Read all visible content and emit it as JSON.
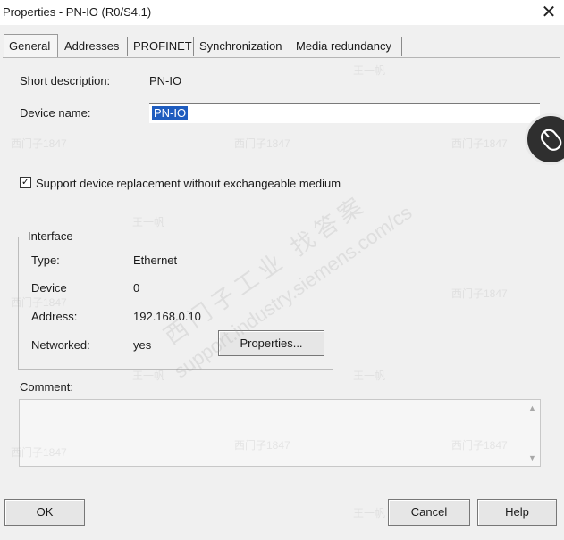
{
  "window": {
    "title": "Properties - PN-IO (R0/S4.1)",
    "close_glyph": "✕"
  },
  "tabs": [
    {
      "label": "General",
      "active": true
    },
    {
      "label": "Addresses",
      "active": false
    },
    {
      "label": "PROFINET",
      "active": false
    },
    {
      "label": "Synchronization",
      "active": false
    },
    {
      "label": "Media redundancy",
      "active": false
    }
  ],
  "general": {
    "short_description_label": "Short description:",
    "short_description_value": "PN-IO",
    "device_name_label": "Device name:",
    "device_name_value": "PN-IO",
    "support_replacement": {
      "label": "Support device replacement without exchangeable medium",
      "checked": true,
      "glyph": "✓"
    }
  },
  "interface": {
    "group_title": "Interface",
    "type_label": "Type:",
    "type_value": "Ethernet",
    "device_label": "Device",
    "device_value": "0",
    "address_label": "Address:",
    "address_value": "192.168.0.10",
    "networked_label": "Networked:",
    "networked_value": "yes",
    "properties_button": "Properties..."
  },
  "comment": {
    "label": "Comment:",
    "value": ""
  },
  "buttons": {
    "ok": "OK",
    "cancel": "Cancel",
    "help": "Help"
  },
  "overlay": {
    "knob_icon": "mouse-icon"
  },
  "watermarks": {
    "small_name": "王一帆",
    "small_id": "西门子1847",
    "big_brand": "西门子工业 找答案",
    "url": "support.industry.siemens.com/cs"
  }
}
